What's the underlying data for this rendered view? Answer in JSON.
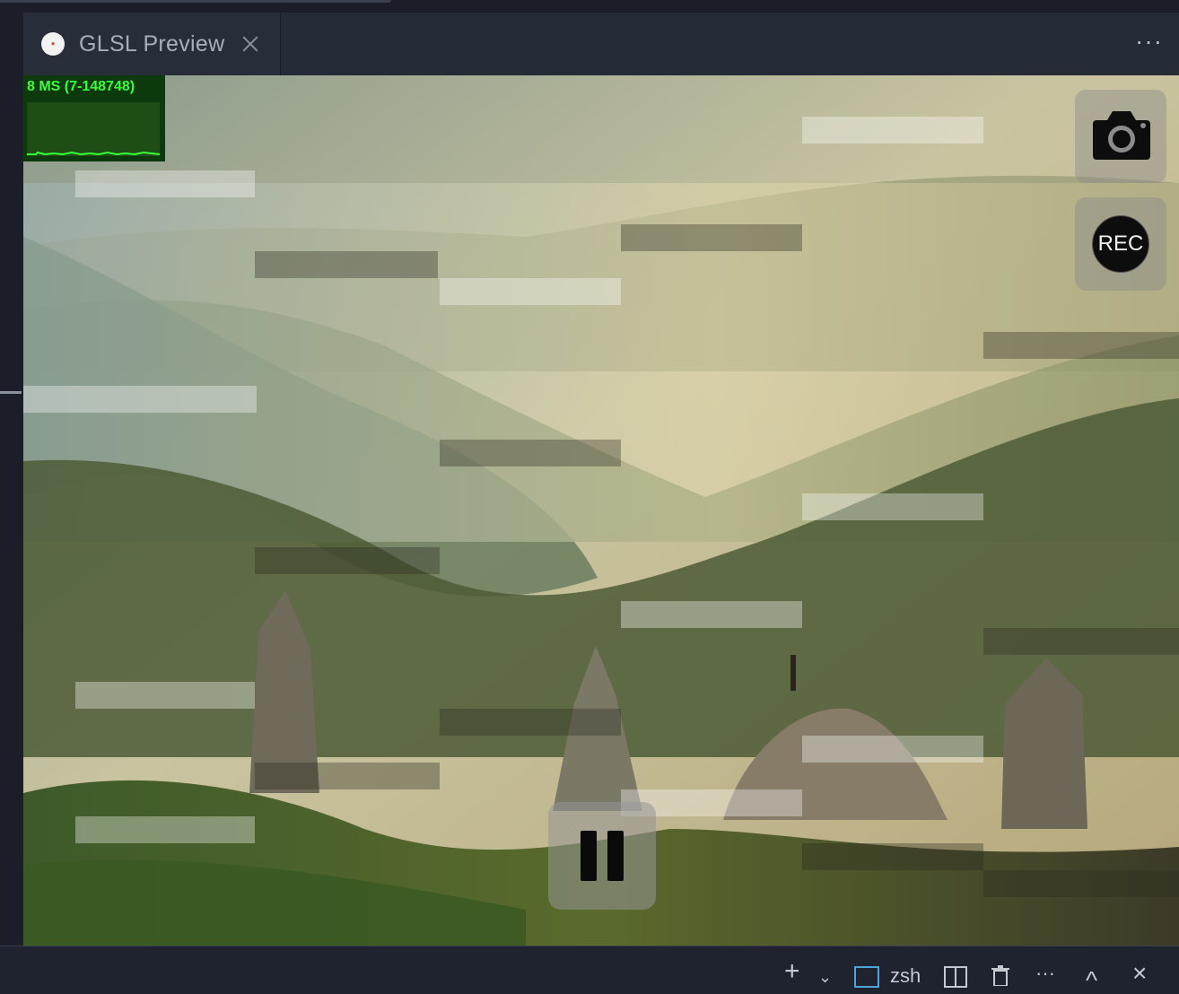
{
  "tab": {
    "title": "GLSL Preview",
    "close_label": "×"
  },
  "header": {
    "more_label": "···"
  },
  "stats": {
    "label": "8 MS (7-148748)",
    "text_color": "#39ff39",
    "bg_color": "#0c3a0c"
  },
  "controls": {
    "rec_label": "REC"
  },
  "terminal": {
    "add_label": "+",
    "chevron_label": "⌄",
    "shell_label": "zsh",
    "more_label": "···",
    "up_label": "^",
    "close_label": "×"
  }
}
